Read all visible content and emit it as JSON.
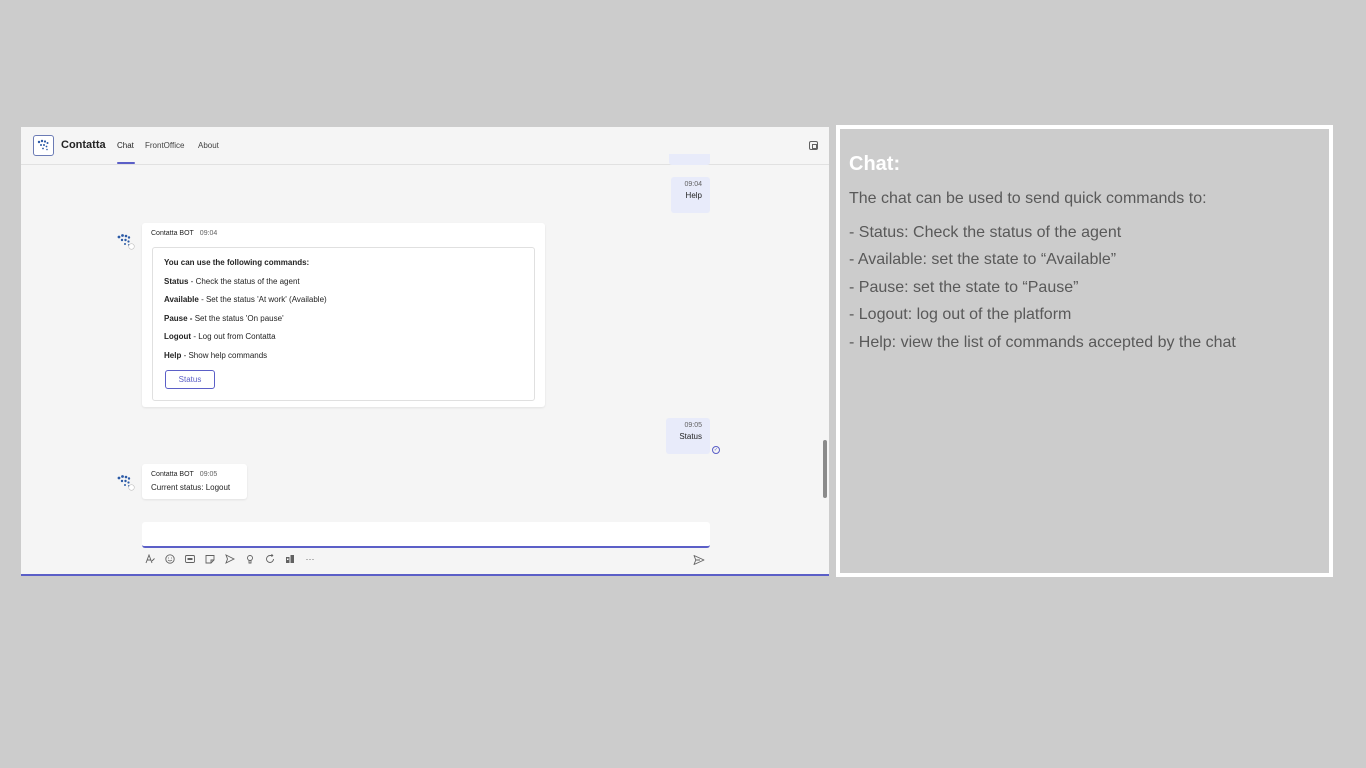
{
  "app": {
    "title": "Contatta",
    "tabs": [
      {
        "label": "Chat"
      },
      {
        "label": "FrontOffice"
      },
      {
        "label": "About"
      }
    ]
  },
  "messages": {
    "help": {
      "time": "09:04",
      "text": "Help"
    },
    "bot1": {
      "sender": "Contatta BOT",
      "time": "09:04",
      "intro": "You can use the following commands:",
      "commands": [
        {
          "name": "Status",
          "sep": " - ",
          "desc": "Check the status of the agent"
        },
        {
          "name": "Available",
          "sep": " - ",
          "desc": "Set the status 'At work' (Available)"
        },
        {
          "name": "Pause -",
          "sep": " ",
          "desc": "Set the status 'On pause'"
        },
        {
          "name": "Logout",
          "sep": " - ",
          "desc": "Log out from Contatta"
        },
        {
          "name": "Help",
          "sep": " - ",
          "desc": "Show help commands"
        }
      ],
      "button_label": "Status"
    },
    "status": {
      "time": "09:05",
      "text": "Status"
    },
    "bot2": {
      "sender": "Contatta BOT",
      "time": "09:05",
      "text": "Current status: Logout"
    }
  },
  "toolbar_icons": [
    "format-icon",
    "emoji-icon",
    "gif-icon",
    "sticker-icon",
    "schedule-icon",
    "praise-icon",
    "loop-icon",
    "apps-icon",
    "more-icon"
  ],
  "panel": {
    "title": "Chat:",
    "intro": "The chat can be used to send quick commands to:",
    "lines": [
      "- Status: Check the status of the agent",
      "- Available: set the state to “Available”",
      "- Pause: set the state to “Pause”",
      "- Logout: log out of the platform",
      "- Help: view the list of commands accepted by the chat"
    ]
  },
  "colors": {
    "accent": "#5b5fc7",
    "background": "#cccccc",
    "self_bubble": "#e8ebfa",
    "panel_text": "#595959"
  }
}
